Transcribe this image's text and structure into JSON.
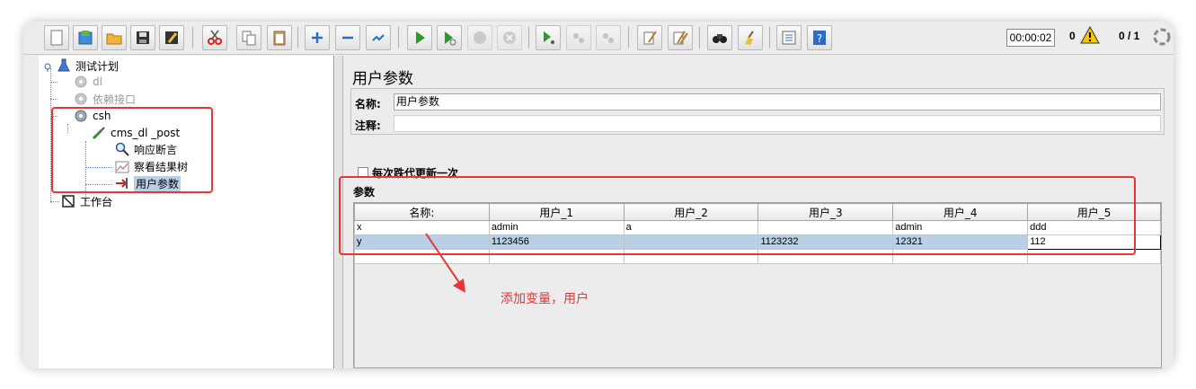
{
  "toolbar": {
    "buttons": [
      "new-icon",
      "templates-icon",
      "open-icon",
      "save-icon",
      "save-as-icon",
      "cut-icon",
      "copy-icon",
      "paste-icon",
      "expand-icon",
      "collapse-icon",
      "toggle-icon",
      "start-icon",
      "start-no-pause-icon",
      "stop-icon",
      "shutdown-icon",
      "remote-start-icon",
      "remote-stop-icon",
      "remote-shutdown-icon",
      "clear-icon",
      "clear-all-icon",
      "search-icon",
      "reset-search-icon",
      "function-helper-icon",
      "help-icon"
    ],
    "timer": "00:00:02",
    "error_count": "0",
    "threads": "0 / 1"
  },
  "tree": {
    "test_plan": "测试计划",
    "dl": "dl",
    "dependency": "依赖接口",
    "csh": "csh",
    "sampler": "cms_dl _post",
    "assertion": "响应断言",
    "result_tree": "察看结果树",
    "user_params": "用户参数",
    "workbench": "工作台"
  },
  "panel": {
    "title": "用户参数",
    "name_label": "名称:",
    "name_value": "用户参数",
    "comment_label": "注释:",
    "comment_value": "",
    "checkbox_label": "每次跌代更新一次",
    "checkbox_checked": false,
    "params_label": "参数"
  },
  "table": {
    "headers": [
      "名称:",
      "用户_1",
      "用户_2",
      "用户_3",
      "用户_4",
      "用户_5"
    ],
    "rows": [
      [
        "x",
        "admin",
        "a",
        "",
        "admin",
        "ddd"
      ],
      [
        "y",
        "1123456",
        "",
        "1123232",
        "12321",
        "112"
      ],
      [
        "",
        "",
        "",
        "",
        "",
        ""
      ]
    ],
    "selected_row": 1
  },
  "annotation": {
    "note": "添加变量，用户",
    "color": "#e83535"
  }
}
